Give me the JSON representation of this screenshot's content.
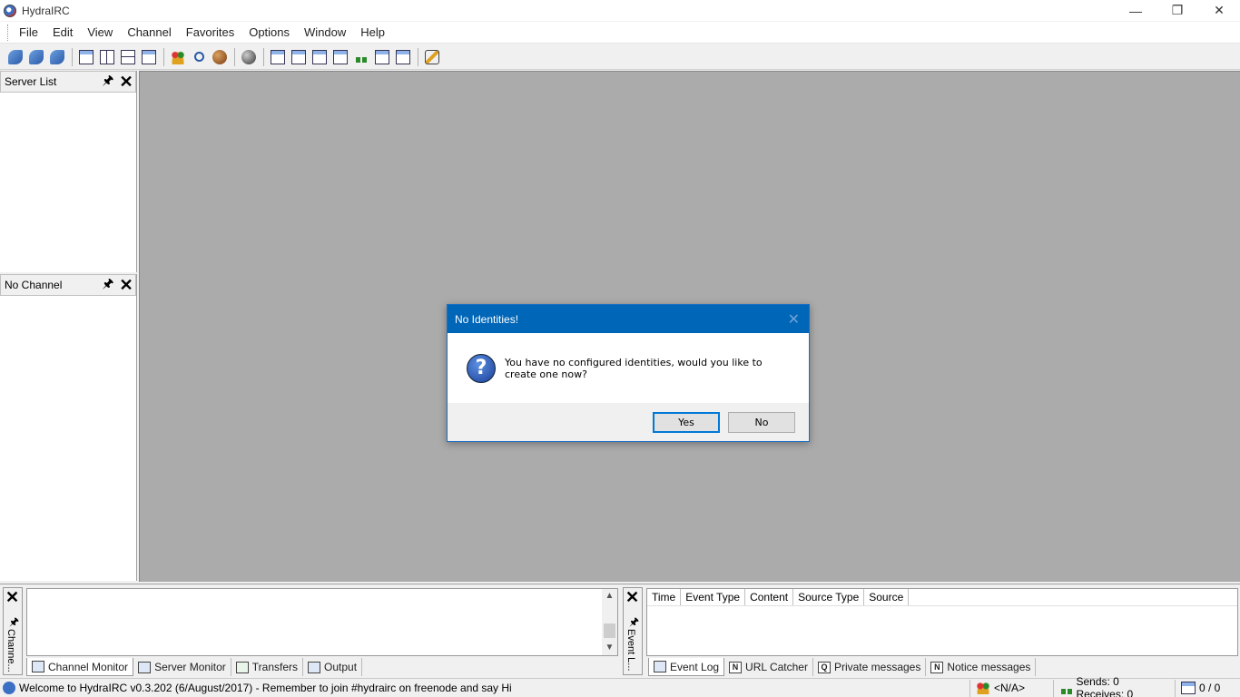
{
  "window": {
    "title": "HydraIRC",
    "minimize": "—",
    "restore": "❐",
    "close": "✕"
  },
  "menu": [
    "File",
    "Edit",
    "View",
    "Channel",
    "Favorites",
    "Options",
    "Window",
    "Help"
  ],
  "toolbar": {
    "icons": [
      "connect-icon",
      "reconnect-icon",
      "disconnect-icon",
      "cascade-windows-icon",
      "tile-vertical-icon",
      "tile-horizontal-icon",
      "print-icon",
      "users-icon",
      "search-icon",
      "favorites-icon",
      "globe-icon",
      "channel-monitor-icon",
      "server-monitor-icon",
      "url-catcher-icon",
      "private-messages-icon",
      "transfers-icon",
      "output-icon",
      "event-log-icon",
      "options-icon"
    ]
  },
  "panels": {
    "server_list": {
      "title": "Server List",
      "pin": "🖈",
      "close": "✕"
    },
    "channel": {
      "title": "No Channel",
      "pin": "🖈",
      "close": "✕"
    }
  },
  "dialog": {
    "title": "No Identities!",
    "close": "✕",
    "message": "You have no configured identities, would you like to create one now?",
    "icon_glyph": "?",
    "yes": "Yes",
    "no": "No"
  },
  "bottom_left": {
    "close": "✕",
    "pin": "🖈",
    "vertical_label": "Channe...",
    "tabs": [
      "Channel Monitor",
      "Server Monitor",
      "Transfers",
      "Output"
    ],
    "active_tab": "Channel Monitor",
    "scroll_up": "▲",
    "scroll_down": "▼"
  },
  "bottom_right": {
    "close": "✕",
    "pin": "🖈",
    "vertical_label": "Event L...",
    "columns": [
      "Time",
      "Event Type",
      "Content",
      "Source Type",
      "Source"
    ],
    "tabs": [
      "Event Log",
      "URL Catcher",
      "Private messages",
      "Notice messages"
    ],
    "tab_letters": [
      "",
      "N",
      "Q",
      "N"
    ],
    "active_tab": "Event Log"
  },
  "statusbar": {
    "message": "Welcome to HydraIRC v0.3.202 (6/August/2017) - Remember to join #hydrairc on freenode and say Hi",
    "identity": "<N/A>",
    "sends_receives": "Sends: 0 Receives: 0",
    "transfers": "0 / 0"
  }
}
